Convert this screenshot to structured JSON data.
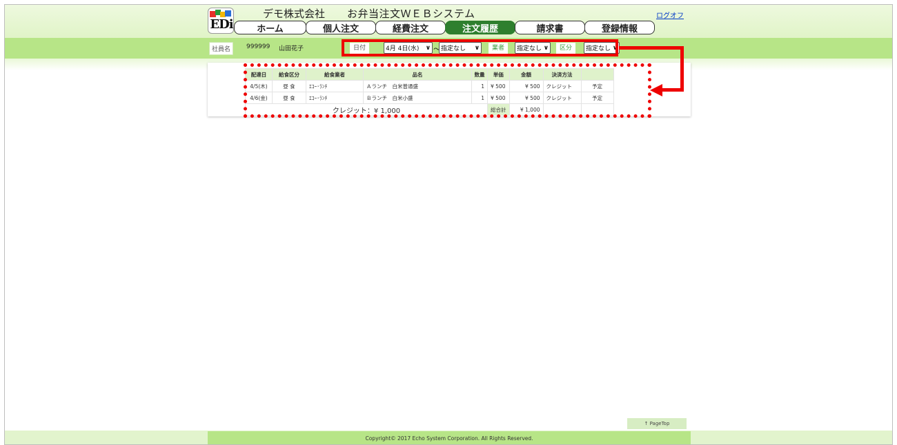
{
  "header": {
    "company": "デモ株式会社",
    "system_title": "お弁当注文ＷＥＢシステム",
    "logout": "ログオフ",
    "logo_text": "EDi"
  },
  "nav": {
    "tabs": [
      {
        "label": "ホーム",
        "active": false
      },
      {
        "label": "個人注文",
        "active": false
      },
      {
        "label": "経費注文",
        "active": false
      },
      {
        "label": "注文履歴",
        "active": true
      },
      {
        "label": "請求書",
        "active": false
      },
      {
        "label": "登録情報",
        "active": false
      }
    ]
  },
  "employee": {
    "label": "社員名",
    "id": "999999",
    "name": "山田花子"
  },
  "filters": {
    "date_label": "日付",
    "date_from": "4月 4日(水)",
    "tilde": "～",
    "date_to": "指定なし",
    "vendor_label": "業者",
    "vendor_value": "指定なし",
    "category_label": "区分",
    "category_value": "指定なし"
  },
  "table": {
    "headers": [
      "配達日",
      "給食区分",
      "給食業者",
      "品名",
      "数量",
      "単価",
      "金額",
      "決済方法",
      ""
    ],
    "rows": [
      [
        "4/5(木)",
        "昼 食",
        "ｴｺｰ･ﾗﾝﾁ",
        "Ａランチ　白米普通盛",
        "1",
        "¥ 500",
        "¥ 500",
        "クレジット",
        "予定"
      ],
      [
        "4/6(金)",
        "昼 食",
        "ｴｺｰ･ﾗﾝﾁ",
        "Ｂランチ　白米小盛",
        "1",
        "¥ 500",
        "¥ 500",
        "クレジット",
        "予定"
      ]
    ],
    "credit_total": "クレジット：¥ 1,000",
    "grand_total_label": "総合計",
    "grand_total_value": "¥ 1,000"
  },
  "page_top": "↑ PageTop",
  "footer": "Copyright© 2017 Echo System Corporation. All Rights Reserved.",
  "colors": {
    "header_green": "#b7e587",
    "active_tab": "#2e7f2e",
    "highlight_red": "#ee0000",
    "table_header": "#dff2cb"
  }
}
